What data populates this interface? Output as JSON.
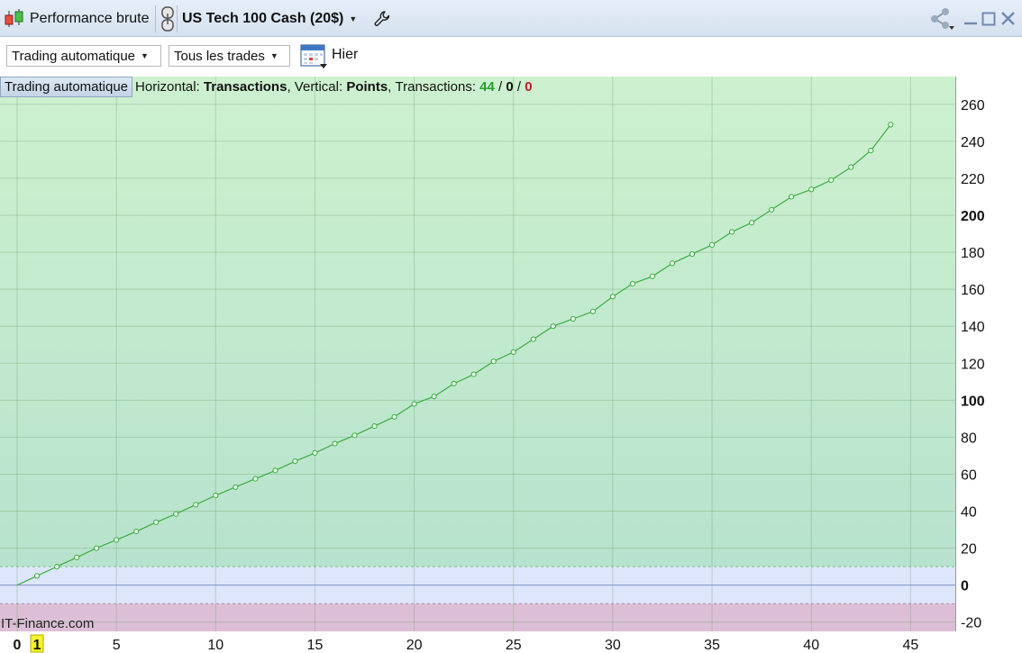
{
  "window": {
    "title": "Performance brute",
    "instrument": "US Tech 100 Cash (20$)",
    "colors": {
      "titlebar": "#dbe5f1",
      "chart_green_top": "#cdf1cf",
      "chart_green_bottom": "#b6e2cc",
      "chart_blue_band": "#dde6fb",
      "chart_pink_band": "#dcbfd6",
      "line": "#3cad40"
    }
  },
  "toolbar": {
    "mode_dropdown": "Trading automatique",
    "trades_dropdown": "Tous les trades",
    "period_label": "Hier"
  },
  "info_bar": {
    "mode_button": "Trading automatique",
    "horizontal_label": "Horizontal:",
    "horizontal_value": "Transactions",
    "vertical_label": "Vertical:",
    "vertical_value": "Points",
    "transactions_label": "Transactions:",
    "transactions_total": "44",
    "transactions_zero": "0",
    "transactions_losing": "0",
    "separator": "/"
  },
  "watermark": "IT-Finance.com",
  "chart_data": {
    "type": "line",
    "xlabel": "",
    "ylabel": "",
    "xlim": [
      0,
      46.5
    ],
    "ylim": [
      -25,
      275
    ],
    "x_ticks": [
      "0",
      "1",
      "5",
      "10",
      "15",
      "20",
      "25",
      "30",
      "35",
      "40",
      "45"
    ],
    "x_tick_values": [
      0,
      1,
      5,
      10,
      15,
      20,
      25,
      30,
      35,
      40,
      45
    ],
    "x_highlight_tick": "1",
    "x_bold_tick": "0",
    "y_ticks": [
      "-20",
      "0",
      "20",
      "40",
      "60",
      "80",
      "100",
      "120",
      "140",
      "160",
      "180",
      "200",
      "220",
      "240",
      "260"
    ],
    "y_tick_values": [
      -20,
      0,
      20,
      40,
      60,
      80,
      100,
      120,
      140,
      160,
      180,
      200,
      220,
      240,
      260
    ],
    "y_bold_ticks": [
      "0",
      "100",
      "200"
    ],
    "bands": {
      "blue": [
        0,
        10
      ],
      "pink": [
        -25,
        -10
      ]
    },
    "grid": true,
    "series": [
      {
        "x": [
          0,
          1,
          2,
          3,
          4,
          5,
          6,
          7,
          8,
          9,
          10,
          11,
          12,
          13,
          14,
          15,
          16,
          17,
          18,
          19,
          20,
          21,
          22,
          23,
          24,
          25,
          26,
          27,
          28,
          29,
          30,
          31,
          32,
          33,
          34,
          35,
          36,
          37,
          38,
          39,
          40,
          41,
          42,
          43,
          44
        ],
        "values": [
          0,
          5,
          10,
          15,
          20,
          24.5,
          29,
          34,
          38.5,
          43.5,
          48.5,
          53,
          57.5,
          62,
          67,
          71.5,
          76.5,
          81,
          86,
          91,
          98,
          102,
          109,
          114,
          121,
          126,
          133,
          140,
          144,
          148,
          156,
          163,
          167,
          174,
          179,
          184,
          191,
          196,
          203,
          210,
          214,
          219,
          226,
          235,
          249
        ]
      }
    ]
  }
}
